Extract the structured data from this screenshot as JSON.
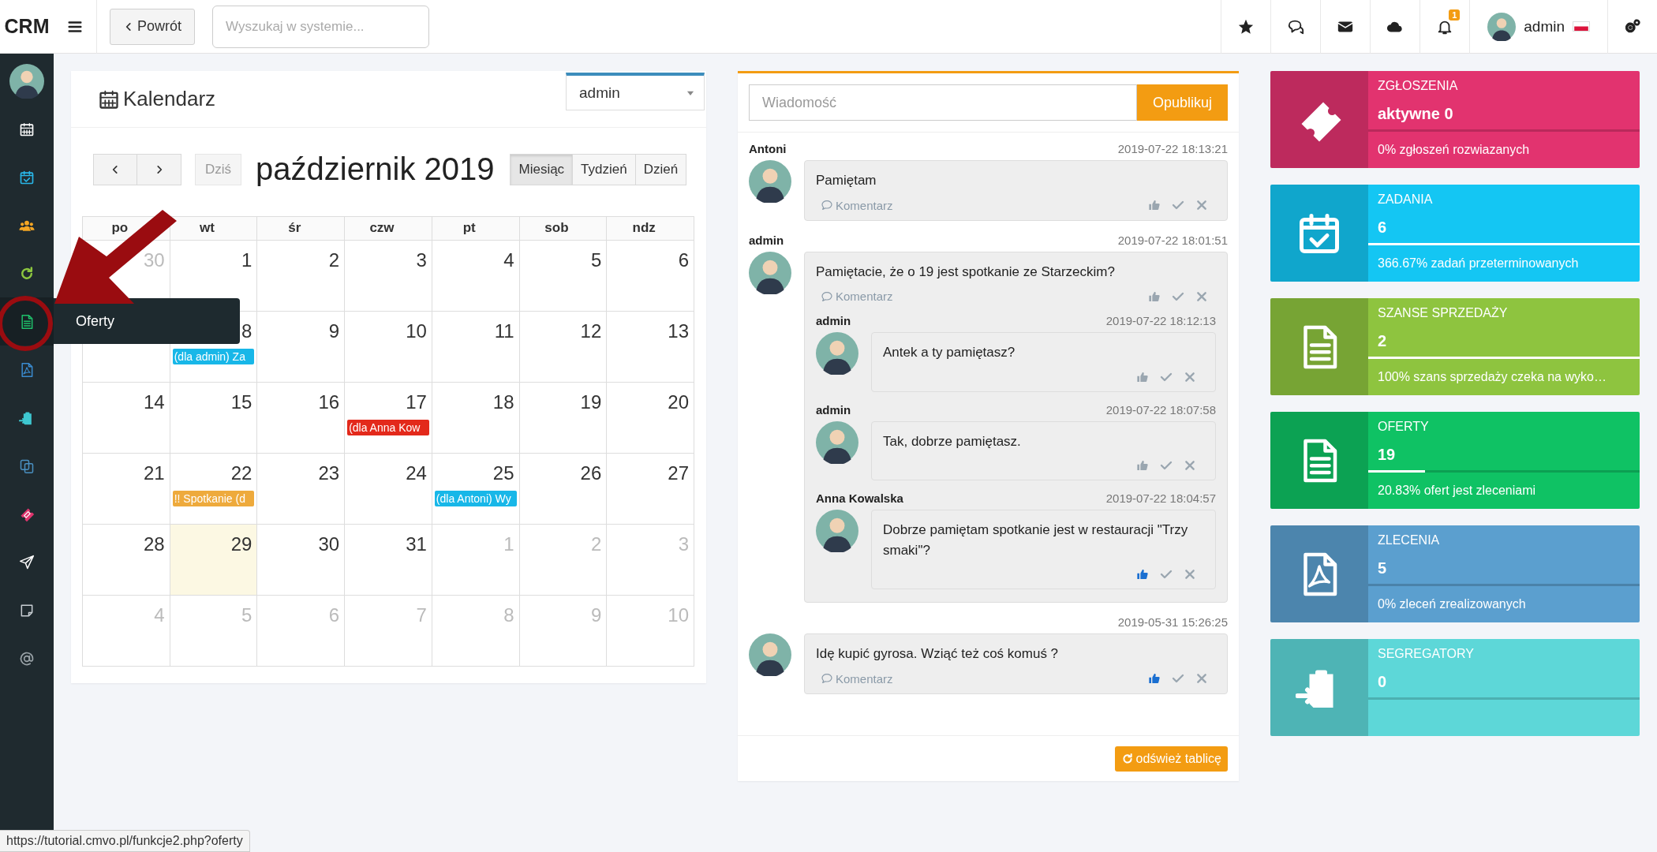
{
  "topbar": {
    "logo": "CRM",
    "back_button": "Powrót",
    "search": {
      "placeholder": "Wyszukaj w systemie..."
    },
    "notifications_badge": "1",
    "user": "admin"
  },
  "sidebar": {
    "tooltip": "Oferty",
    "items": [
      {
        "color": "#ffffff",
        "hovered": false
      },
      {
        "color": "#29b6e8",
        "hovered": false
      },
      {
        "color": "#f5a623",
        "hovered": false
      },
      {
        "color": "#8cc63f",
        "hovered": false
      },
      {
        "color": "#1fbf6a",
        "hovered": true
      },
      {
        "color": "#3a8bd0",
        "hovered": false
      },
      {
        "color": "#3ec7d0",
        "hovered": false
      },
      {
        "color": "#4a90c2",
        "hovered": false
      },
      {
        "color": "#e0356e",
        "hovered": false
      },
      {
        "color": "#ffffff",
        "hovered": false
      },
      {
        "color": "#c8ced3",
        "hovered": false
      },
      {
        "color": "#9aa3a8",
        "hovered": false
      }
    ]
  },
  "calendar": {
    "title": "Kalendarz",
    "user_select": "admin",
    "today_button": "Dziś",
    "month": "październik 2019",
    "views": [
      {
        "label": "Miesiąc",
        "selected": true
      },
      {
        "label": "Tydzień",
        "selected": false
      },
      {
        "label": "Dzień",
        "selected": false
      }
    ],
    "weekdays": [
      "po",
      "wt",
      "śr",
      "czw",
      "pt",
      "sob",
      "ndz"
    ],
    "weeks": [
      [
        {
          "day": "30",
          "other_month": true,
          "today": false
        },
        {
          "day": "1",
          "other_month": false,
          "today": false
        },
        {
          "day": "2",
          "other_month": false,
          "today": false
        },
        {
          "day": "3",
          "other_month": false,
          "today": false
        },
        {
          "day": "4",
          "other_month": false,
          "today": false
        },
        {
          "day": "5",
          "other_month": false,
          "today": false
        },
        {
          "day": "6",
          "other_month": false,
          "today": false
        }
      ],
      [
        {
          "today": false
        },
        {
          "day": "8",
          "other_month": false,
          "today": false,
          "event": {
            "text": "(dla admin) Za",
            "color": "#18b7e8"
          }
        },
        {
          "day": "9",
          "other_month": false,
          "today": false
        },
        {
          "day": "10",
          "other_month": false,
          "today": false
        },
        {
          "day": "11",
          "other_month": false,
          "today": false
        },
        {
          "day": "12",
          "other_month": false,
          "today": false
        },
        {
          "day": "13",
          "other_month": false,
          "today": false
        }
      ],
      [
        {
          "day": "14",
          "other_month": false,
          "today": false
        },
        {
          "day": "15",
          "other_month": false,
          "today": false
        },
        {
          "day": "16",
          "other_month": false,
          "today": false
        },
        {
          "day": "17",
          "other_month": false,
          "today": false,
          "event": {
            "text": "(dla Anna Kow",
            "color": "#e3291b"
          }
        },
        {
          "day": "18",
          "other_month": false,
          "today": false
        },
        {
          "day": "19",
          "other_month": false,
          "today": false
        },
        {
          "day": "20",
          "other_month": false,
          "today": false
        }
      ],
      [
        {
          "day": "21",
          "other_month": false,
          "today": false
        },
        {
          "day": "22",
          "other_month": false,
          "today": false,
          "event": {
            "text": "!! Spotkanie (d",
            "color": "#eeaa3c"
          }
        },
        {
          "day": "23",
          "other_month": false,
          "today": false
        },
        {
          "day": "24",
          "other_month": false,
          "today": false
        },
        {
          "day": "25",
          "other_month": false,
          "today": false,
          "event": {
            "text": "(dla Antoni) Wy",
            "color": "#18b7e8"
          }
        },
        {
          "day": "26",
          "other_month": false,
          "today": false
        },
        {
          "day": "27",
          "other_month": false,
          "today": false
        }
      ],
      [
        {
          "day": "28",
          "other_month": false,
          "today": false
        },
        {
          "day": "29",
          "other_month": false,
          "today": true
        },
        {
          "day": "30",
          "other_month": false,
          "today": false
        },
        {
          "day": "31",
          "other_month": false,
          "today": false
        },
        {
          "day": "1",
          "other_month": true,
          "today": false
        },
        {
          "day": "2",
          "other_month": true,
          "today": false
        },
        {
          "day": "3",
          "other_month": true,
          "today": false
        }
      ],
      [
        {
          "day": "4",
          "other_month": true,
          "today": false
        },
        {
          "day": "5",
          "other_month": true,
          "today": false
        },
        {
          "day": "6",
          "other_month": true,
          "today": false
        },
        {
          "day": "7",
          "other_month": true,
          "today": false
        },
        {
          "day": "8",
          "other_month": true,
          "today": false
        },
        {
          "day": "9",
          "other_month": true,
          "today": false
        },
        {
          "day": "10",
          "other_month": true,
          "today": false
        }
      ]
    ]
  },
  "chat": {
    "composer": {
      "placeholder": "Wiadomość",
      "button": "Opublikuj"
    },
    "posts": [
      {
        "author": "Antoni",
        "time": "2019-07-22 18:13:21",
        "text": "Pamiętam",
        "comment_link": "Komentarz",
        "liked": false
      },
      {
        "author": "admin",
        "time": "2019-07-22 18:01:51",
        "text": "Pamiętacie, że o 19 jest spotkanie ze Starzeckim?",
        "comment_link": "Komentarz",
        "liked": false,
        "replies": [
          {
            "author": "admin",
            "time": "2019-07-22 18:12:13",
            "text": "Antek a ty pamiętasz?",
            "liked": false
          },
          {
            "author": "admin",
            "time": "2019-07-22 18:07:58",
            "text": "Tak, dobrze pamiętasz.",
            "liked": false
          },
          {
            "author": "Anna Kowalska",
            "time": "2019-07-22 18:04:57",
            "text": "Dobrze pamiętam spotkanie jest w restauracji \"Trzy smaki\"?",
            "liked": true
          }
        ]
      },
      {
        "time": "2019-05-31 15:26:25",
        "text": "Idę kupić gyrosa. Wziąć też coś komuś ?",
        "comment_link": "Komentarz",
        "liked": true
      }
    ],
    "refresh_button": "odśwież tablicę"
  },
  "stats": [
    {
      "title": "ZGŁOSZENIA",
      "value": "aktywne 0",
      "footer": "0% zgłoszeń rozwiazanych",
      "level": 0,
      "color": "#e2336f"
    },
    {
      "title": "ZADANIA",
      "value": "6",
      "footer": "366.67% zadań przeterminowanych",
      "level": 1,
      "color": "#14c6f3"
    },
    {
      "title": "SZANSE SPRZEDAŻY",
      "value": "2",
      "footer": "100% szans sprzedaży czeka na wyko…",
      "level": 1,
      "color": "#8ec43f"
    },
    {
      "title": "OFERTY",
      "value": "19",
      "footer": "20.83% ofert jest zleceniami",
      "level": 0.2083,
      "color": "#0fc264"
    },
    {
      "title": "ZLECENIA",
      "value": "5",
      "footer": "0% zleceń zrealizowanych",
      "level": 0,
      "color": "#5b9fcf"
    },
    {
      "title": "SEGREGATORY",
      "value": "0",
      "level": 0,
      "color": "#5dd7d8"
    }
  ],
  "status_bar": {
    "url": "https://tutorial.cmvo.pl/funkcje2.php?oferty"
  }
}
